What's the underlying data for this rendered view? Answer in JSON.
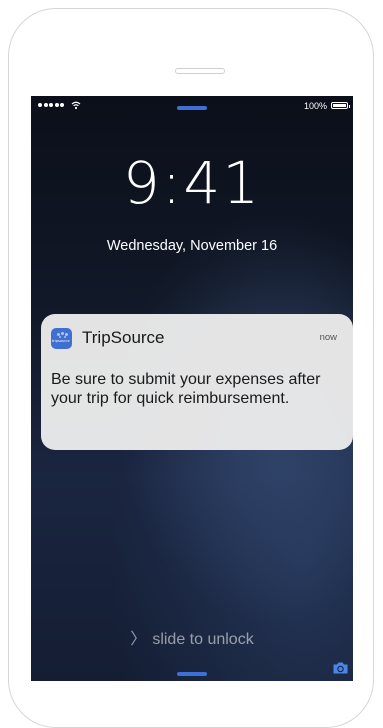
{
  "status_bar": {
    "battery_percent": "100%"
  },
  "lock_screen": {
    "time": "9:41",
    "date": "Wednesday, November 16",
    "unlock_hint": "slide to unlock"
  },
  "notification": {
    "app_name": "TripSource",
    "app_icon_text": "tripsource",
    "timestamp": "now",
    "message": "Be sure to submit your expenses after your trip for quick reimbursement."
  },
  "icons": {
    "wifi": "wifi-icon",
    "battery": "battery-icon",
    "camera": "camera-icon",
    "unlock_chevron": "chevron-right-icon"
  },
  "colors": {
    "grabber": "#3d6fd6",
    "app_icon": "#3f6fd0",
    "notification_bg": "#eaeaea"
  }
}
